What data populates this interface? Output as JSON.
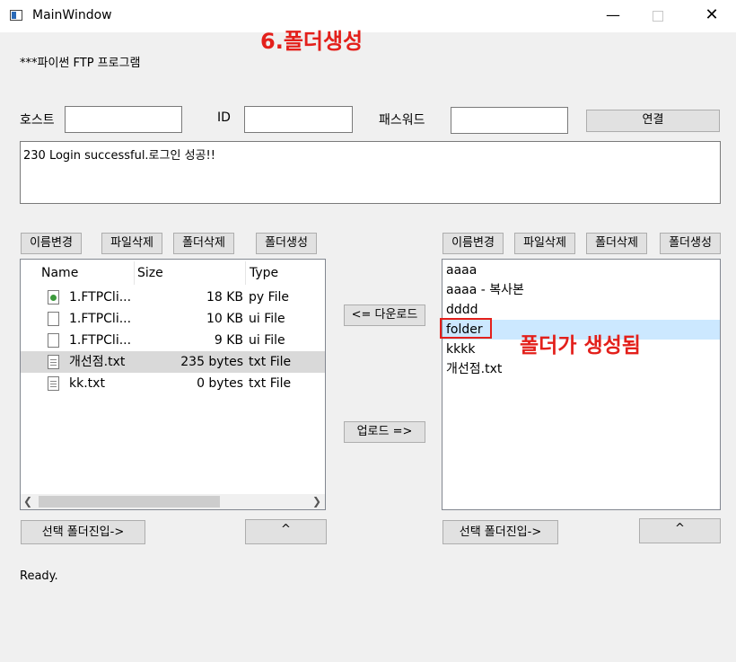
{
  "window": {
    "title": "MainWindow",
    "minimize": "—",
    "close": "✕"
  },
  "annotations": {
    "step_title": "6.폴더생성",
    "folder_created": "폴더가 생성됨"
  },
  "app": {
    "heading": "***파이썬 FTP 프로그램"
  },
  "login": {
    "host_label": "호스트",
    "host_value": "",
    "id_label": "ID",
    "id_value": "",
    "password_label": "패스워드",
    "password_value": "",
    "connect_label": "연결"
  },
  "log": {
    "text": "230 Login successful.로그인 성공!!"
  },
  "local": {
    "rename_label": "이름변경",
    "delete_file_label": "파일삭제",
    "delete_folder_label": "폴더삭제",
    "create_folder_label": "폴더생성",
    "columns": [
      "Name",
      "Size",
      "Type"
    ],
    "files": [
      {
        "name": "1.FTPCli...",
        "size": "18 KB",
        "type": "py File",
        "icon": "python-file-icon"
      },
      {
        "name": "1.FTPCli...",
        "size": "10 KB",
        "type": "ui File",
        "icon": "file-icon"
      },
      {
        "name": "1.FTPCli...",
        "size": "9 KB",
        "type": "ui File",
        "icon": "file-icon"
      },
      {
        "name": "개선점.txt",
        "size": "235 bytes",
        "type": "txt File",
        "icon": "text-file-icon"
      },
      {
        "name": "kk.txt",
        "size": "0 bytes",
        "type": "txt File",
        "icon": "text-file-icon"
      }
    ],
    "enter_folder_label": "선택 폴더진입->",
    "up_label": "^"
  },
  "transfer": {
    "download_label": "<= 다운로드",
    "upload_label": "업로드 =>"
  },
  "remote": {
    "rename_label": "이름변경",
    "delete_file_label": "파일삭제",
    "delete_folder_label": "폴더삭제",
    "create_folder_label": "폴더생성",
    "items": [
      "aaaa",
      "aaaa - 복사본",
      "dddd",
      "folder",
      "kkkk",
      "개선점.txt"
    ],
    "selected_item": "folder",
    "enter_folder_label": "선택 폴더진입->",
    "up_label": "^"
  },
  "status": {
    "text": "Ready."
  },
  "colors": {
    "annotation": "#e3201b",
    "selection": "#cce8ff"
  }
}
